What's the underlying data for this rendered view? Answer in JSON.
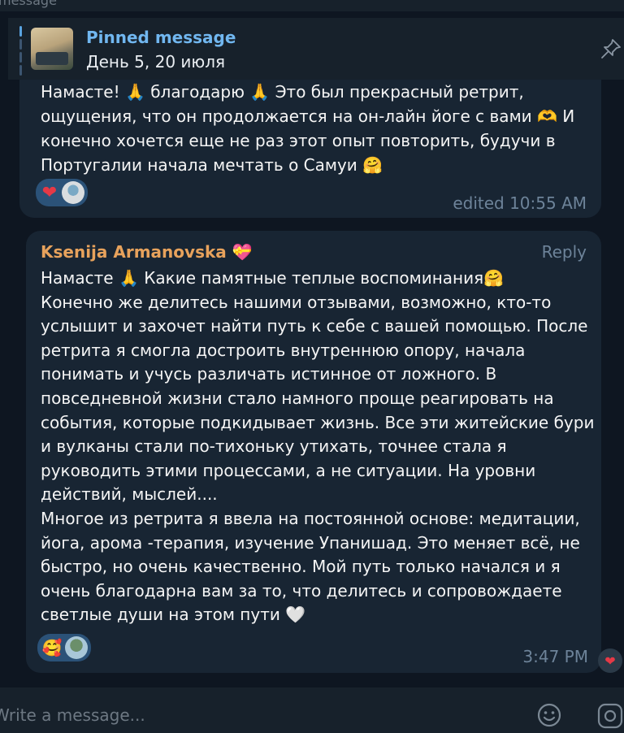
{
  "header_fragment": "message",
  "pinned": {
    "title": "Pinned message",
    "text": "День 5, 20 июля"
  },
  "message1": {
    "text": "Намасте! 🙏 благодарю 🙏 Это был прекрасный ретрит, ощущения, что он продолжается на он-лайн йоге с вами 🫶 И конечно хочется еще не раз этот опыт повторить, будучи в Португалии начала мечтать о Самуи 🤗",
    "time": "edited 10:55 AM",
    "reaction": "❤"
  },
  "message2": {
    "author": "Ksenija Armanovska 💝",
    "reply_label": "Reply",
    "text": "Намасте 🙏 Какие памятные теплые воспоминания🤗\nКонечно же делитесь нашими отзывами, возможно, кто-то услышит и захочет найти путь к себе с вашей помощью. После ретрита я смогла достроить внутреннюю опору, начала понимать и учусь различать истинное от ложного. В повседневной жизни стало намного проще реагировать на события, которые подкидывает жизнь. Все эти житейские бури и вулканы стали по-тихоньку утихать, точнее стала я руководить этими процессами, а не ситуации. На уровни действий, мыслей....\nМногое из ретрита я ввела на постоянной основе: медитации, йога, арома -терапия, изучение Упанишад. Это меняет всё, не быстро, но очень качественно. Мой путь только начался и я очень благодарна вам за то, что делитесь и сопровождаете светлые души на этом пути 🤍",
    "time": "3:47 PM",
    "reaction": "🥰"
  },
  "side_reaction": "❤",
  "composer": {
    "placeholder": "Write a message..."
  },
  "colors": {
    "background": "#0e1621",
    "bubble": "#182533",
    "accent": "#71b7f0",
    "author": "#e7a25c"
  }
}
